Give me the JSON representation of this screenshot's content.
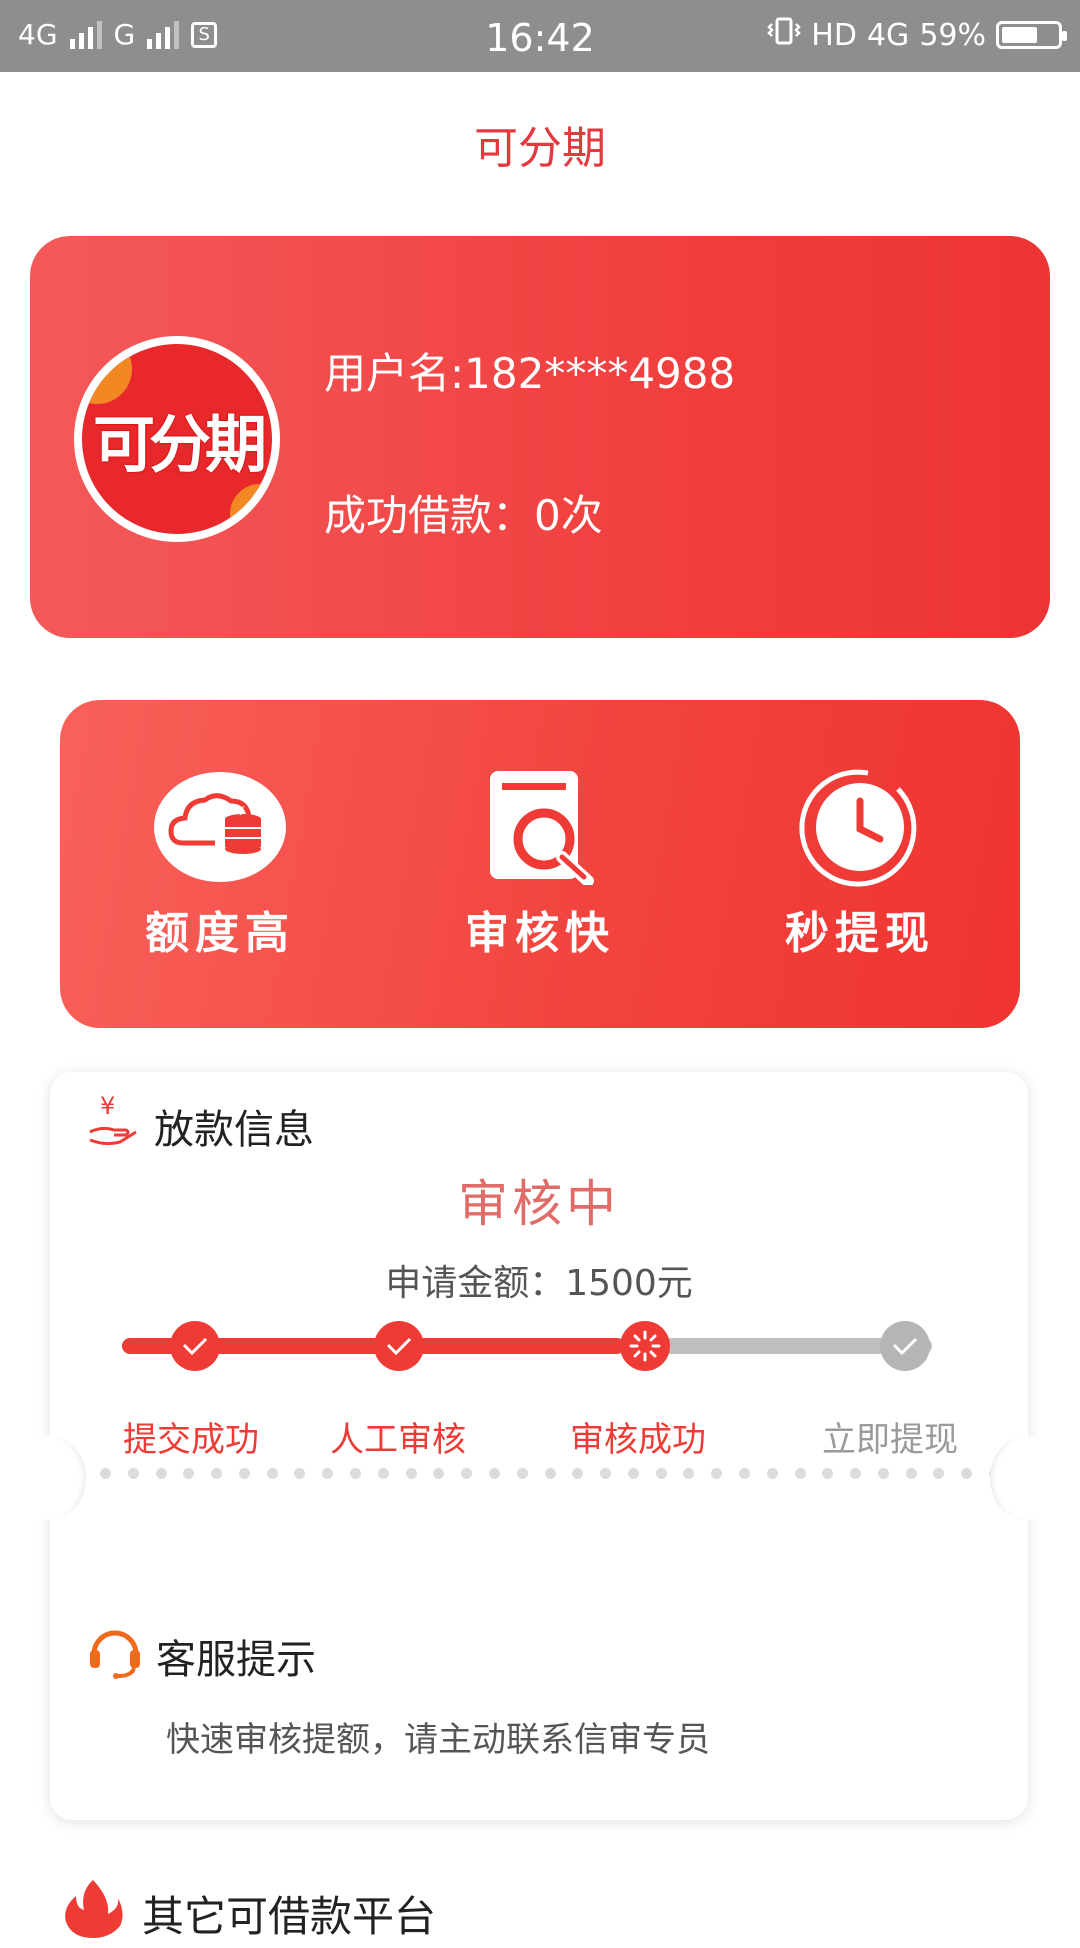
{
  "status_bar": {
    "network1": "4G",
    "network2": "G",
    "sim_icon": "S",
    "time": "16:42",
    "hd": "HD",
    "net_right": "4G",
    "battery": "59%"
  },
  "page": {
    "title": "可分期"
  },
  "profile": {
    "avatar_text": "可分期",
    "username": "用户名:182****4988",
    "loans": "成功借款：0次"
  },
  "features": [
    {
      "label": "额度高",
      "icon": "cloud-coins-icon"
    },
    {
      "label": "审核快",
      "icon": "document-search-icon"
    },
    {
      "label": "秒提现",
      "icon": "clock-icon"
    }
  ],
  "loan_info": {
    "title": "放款信息",
    "status": "审核中",
    "amount": "申请金额：1500元",
    "progress_fraction": 0.62,
    "steps": [
      {
        "label": "提交成功",
        "state": "done"
      },
      {
        "label": "人工审核",
        "state": "done"
      },
      {
        "label": "审核成功",
        "state": "in-progress"
      },
      {
        "label": "立即提现",
        "state": "pending"
      }
    ]
  },
  "support": {
    "title": "客服提示",
    "text": "快速审核提额，请主动联系信审专员"
  },
  "other": {
    "title": "其它可借款平台"
  },
  "colors": {
    "brand_red": "#ef3b36",
    "title_red": "#e23a3f",
    "status_text": "#e06b67",
    "pending_gray": "#bfbfbf"
  }
}
